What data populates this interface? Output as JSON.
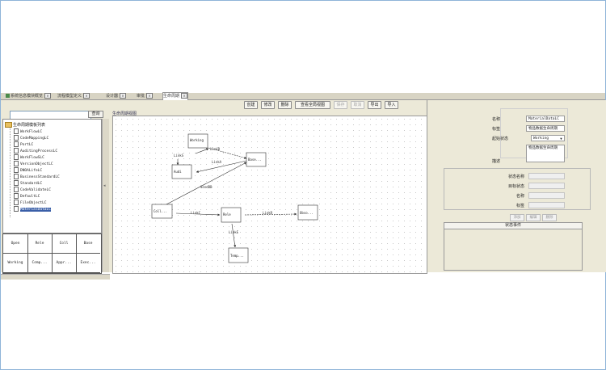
{
  "tabs": [
    {
      "label": "系统信息模块概览"
    },
    {
      "label": "流程模型定义"
    },
    {
      "label": "设计器"
    },
    {
      "label": "审批"
    },
    {
      "label": "生命周期"
    }
  ],
  "left": {
    "search_value": "",
    "search_button": "查询",
    "tree_root": "生命周期模板列表",
    "tree_items": [
      "WorkFlowLC",
      "CodeMappingLC",
      "PortLC",
      "AuditingProcessLC",
      "WorkFlowSLC",
      "VersionObjectLC",
      "DNOALifeLC",
      "BusinessStandardLC",
      "StandardLC",
      "CodeValidateLC",
      "DefaultLC",
      "FileObjectLC",
      "MaterialDataLC"
    ],
    "table": [
      [
        "Open",
        "Rele",
        "Coll",
        "Base"
      ],
      [
        "Working",
        "Comp...",
        "Appr...",
        "Exec..."
      ]
    ]
  },
  "toolbar": {
    "buttons": [
      "创建",
      "修改",
      "删除",
      "查看全局视图",
      "保存",
      "取消",
      "导出",
      "导入"
    ]
  },
  "diagram": {
    "title": "生命周期视图",
    "nodes": [
      {
        "id": "working",
        "label": "Working"
      },
      {
        "id": "audit",
        "label": "Audi"
      },
      {
        "id": "base",
        "label": "Base..."
      },
      {
        "id": "coll",
        "label": "Coll..."
      },
      {
        "id": "rele",
        "label": "Rele"
      },
      {
        "id": "obso",
        "label": "Obso..."
      },
      {
        "id": "temp",
        "label": "Temp..."
      }
    ],
    "edges": [
      {
        "label": "LinkB"
      },
      {
        "label": "LinkA"
      },
      {
        "label": "LinkS"
      },
      {
        "label": "SendBB"
      },
      {
        "label": "LinkC"
      },
      {
        "label": "LinkR"
      },
      {
        "label": "LinkE"
      }
    ]
  },
  "right": {
    "name_label": "名称",
    "name_value": "MaterialDataLC",
    "tag_label": "标签",
    "tag_value": "物品数据生命周期",
    "init_state_label": "起始状态",
    "init_state_value": "Working",
    "desc_label": "描述",
    "desc_value": "物品数据生命周期",
    "state_name_label": "状态名称",
    "target_state_label": "目标状态",
    "event_name_label": "名称",
    "event_label_label": "标签",
    "state_buttons": [
      "添加",
      "编辑",
      "删除"
    ],
    "list_header": "状态事件"
  }
}
